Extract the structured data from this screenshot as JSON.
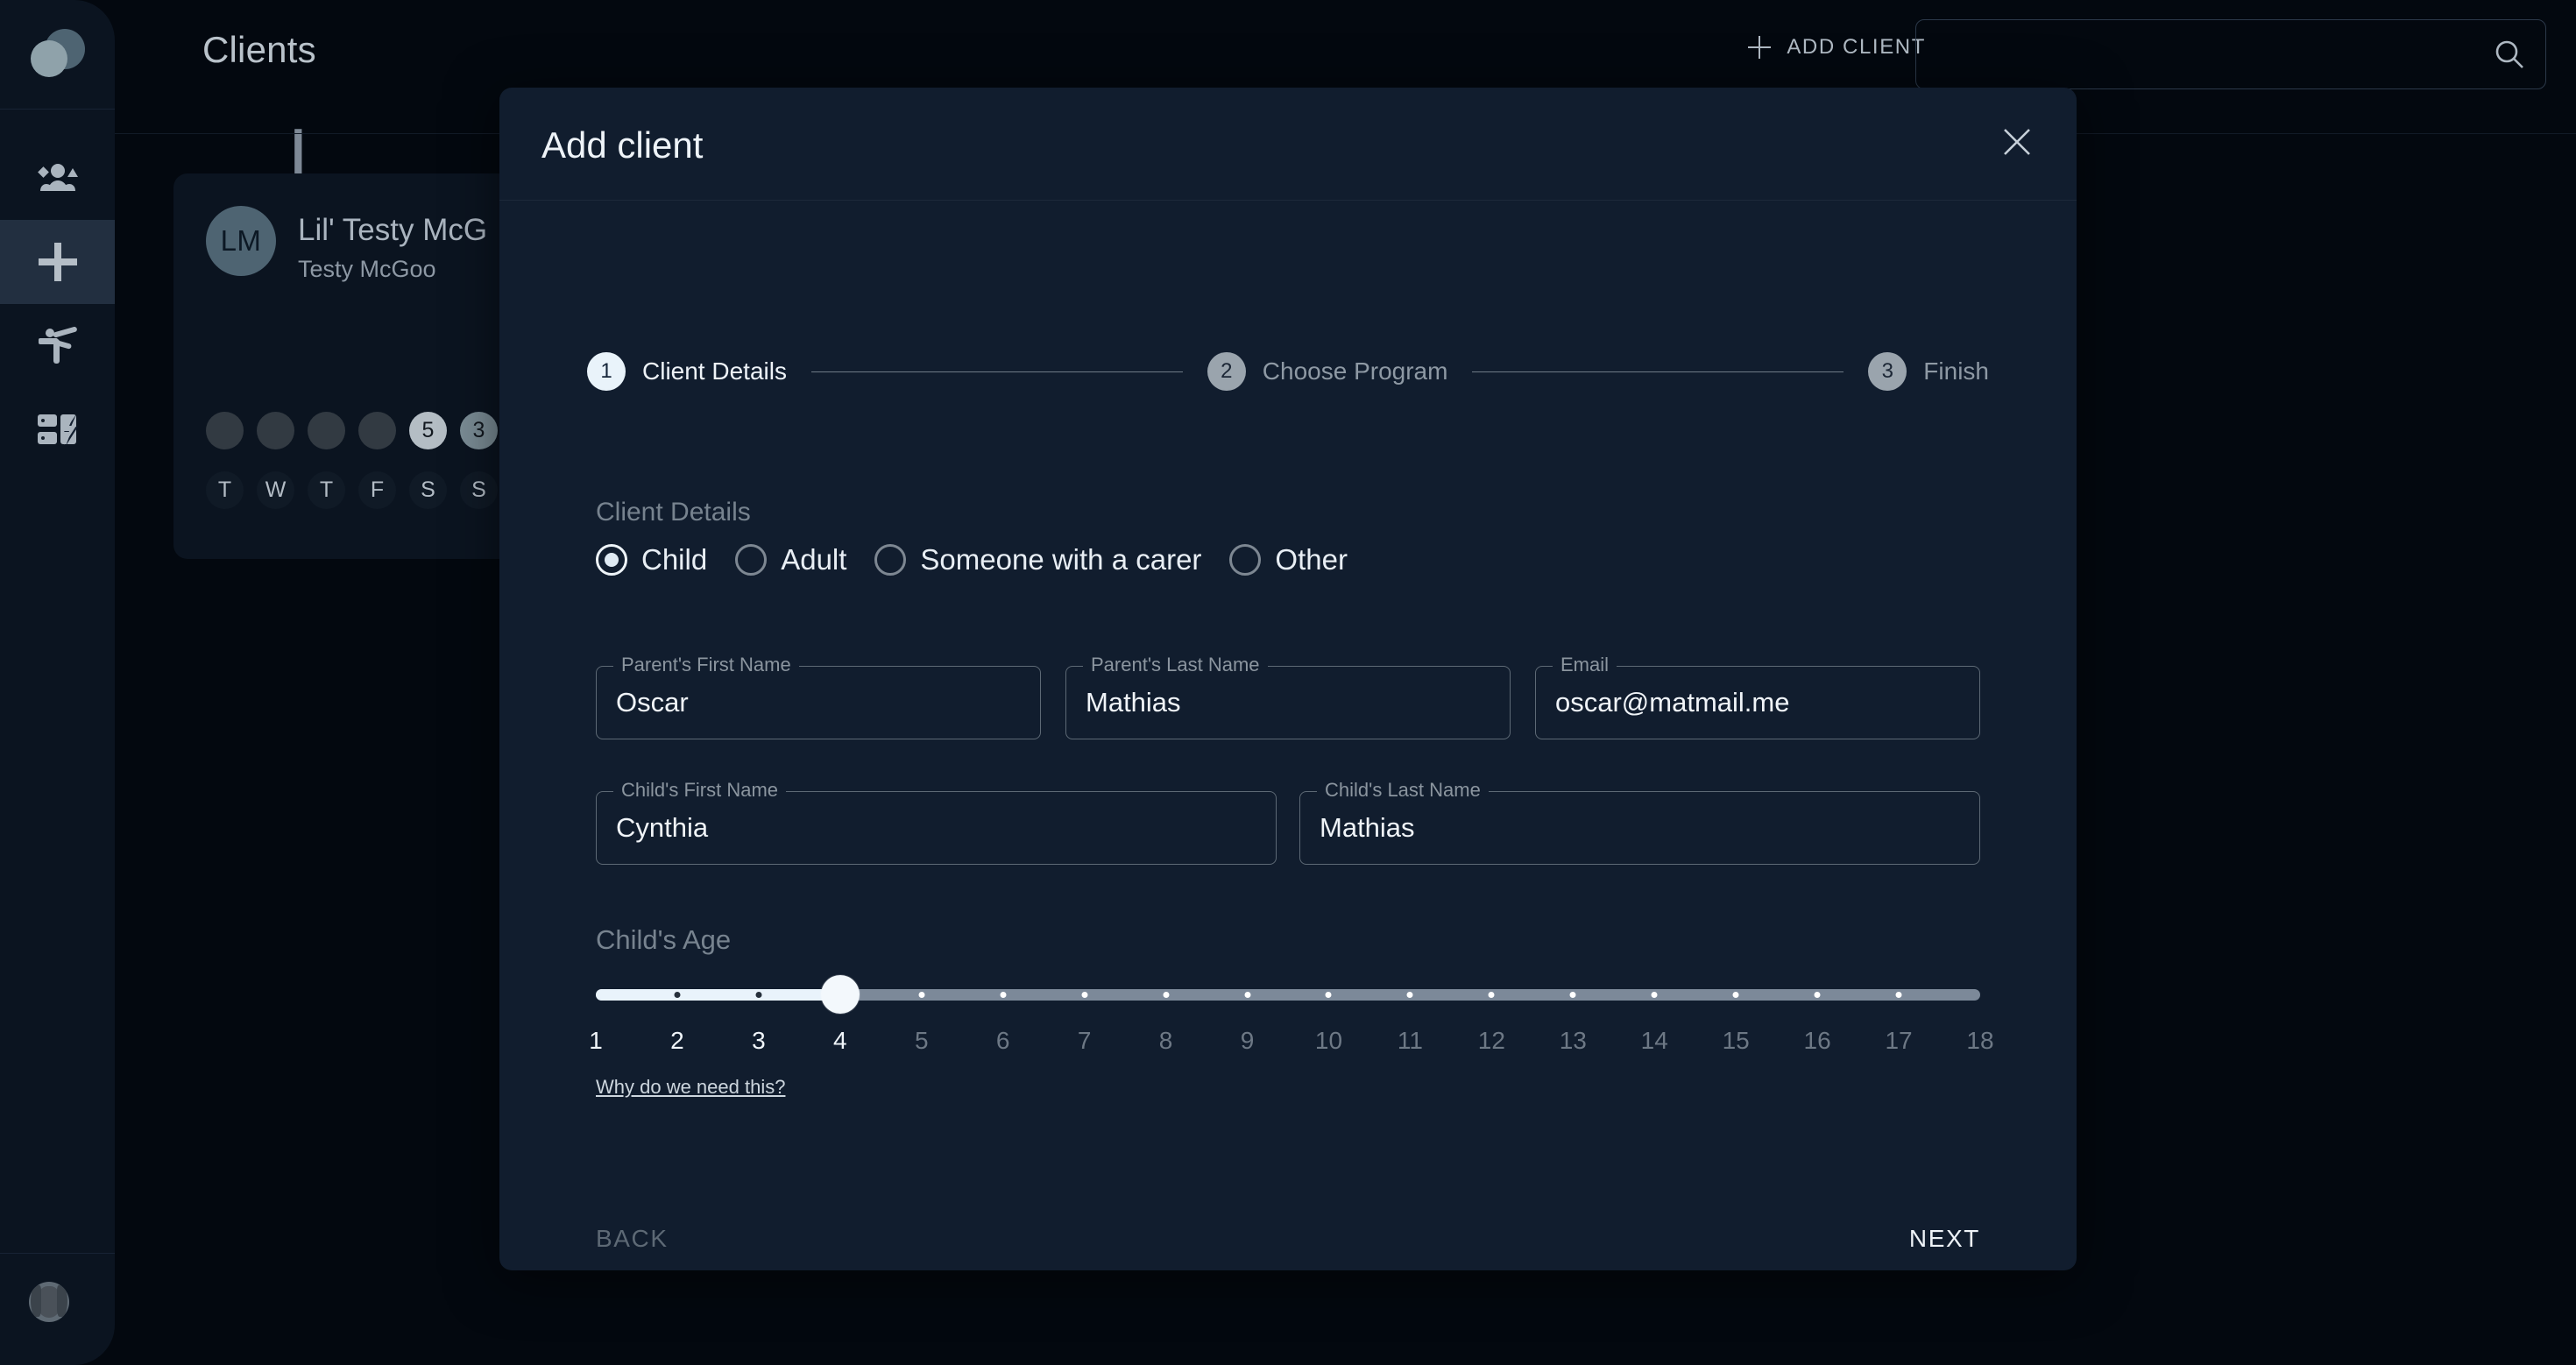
{
  "app": {
    "logo": "logo-mark",
    "expand_arrow": "›"
  },
  "sidebar": {
    "items": [
      {
        "name": "clients",
        "icon": "people-group-icon",
        "active": false
      },
      {
        "name": "add",
        "icon": "plus-icon",
        "active": true
      },
      {
        "name": "programs",
        "icon": "martial-arts-figure-icon",
        "active": false
      },
      {
        "name": "drills",
        "icon": "flash-cards-icon",
        "active": false
      }
    ],
    "profile_avatar": "user-avatar"
  },
  "topbar": {
    "title": "Clients",
    "add_client_label": "ADD CLIENT",
    "search_value": "",
    "search_placeholder": ""
  },
  "main": {
    "alpha_header": "L",
    "client_card": {
      "initials": "LM",
      "name": "Lil' Testy McG",
      "subtitle": "Testy McGoo",
      "counters": [
        "",
        "",
        "",
        "",
        "5",
        "3",
        ""
      ],
      "days": [
        "T",
        "W",
        "T",
        "F",
        "S",
        "S"
      ]
    }
  },
  "modal": {
    "title": "Add client",
    "close_label": "✕",
    "steps": [
      {
        "num": "1",
        "label": "Client Details",
        "state": "active"
      },
      {
        "num": "2",
        "label": "Choose Program",
        "state": "idle"
      },
      {
        "num": "3",
        "label": "Finish",
        "state": "idle"
      }
    ],
    "section_title": "Client Details",
    "client_type": {
      "selected": "Child",
      "options": [
        "Child",
        "Adult",
        "Someone with a carer",
        "Other"
      ]
    },
    "fields": [
      {
        "label": "Parent's First Name",
        "value": "Oscar"
      },
      {
        "label": "Parent's Last Name",
        "value": "Mathias"
      },
      {
        "label": "Email",
        "value": "oscar@matmail.me"
      },
      {
        "label": "Child's First Name",
        "value": "Cynthia"
      },
      {
        "label": "Child's Last Name",
        "value": "Mathias"
      }
    ],
    "age_slider": {
      "label": "Child's Age",
      "value": 4,
      "min": 1,
      "max": 18,
      "ticks": [
        1,
        2,
        3,
        4,
        5,
        6,
        7,
        8,
        9,
        10,
        11,
        12,
        13,
        14,
        15,
        16,
        17,
        18
      ]
    },
    "why_link": "Why do we need this?",
    "back_label": "BACK",
    "next_label": "NEXT"
  },
  "colors": {
    "page_bg": "#03080f",
    "panel_bg": "#0b1420",
    "modal_bg": "#111d2e",
    "accent_light": "#e9f3fa",
    "muted": "#77838f",
    "track_inactive": "#7c8999"
  }
}
